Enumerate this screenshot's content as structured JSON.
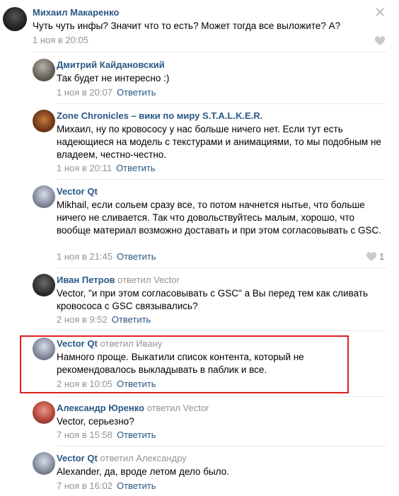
{
  "comments": [
    {
      "author": "Михаил Макаренко",
      "replied": "",
      "text": "Чуть чуть инфы? Значит что то есть? Может тогда все выложите? А?",
      "time": "1 ноя в 20:05",
      "reply": ""
    },
    {
      "author": "Дмитрий Кайдановский",
      "replied": "",
      "text": "Так будет не интересно :)",
      "time": "1 ноя в 20:07",
      "reply": "Ответить"
    },
    {
      "author": "Zone Chronicles – вики по миру S.T.A.L.K.E.R.",
      "replied": "",
      "text": "Михаил, ну по кровососу у нас больше ничего нет. Если тут есть надеющиеся на модель с текстурами и анимациями, то мы подобным не владеем, честно-честно.",
      "time": "1 ноя в 20:11",
      "reply": "Ответить"
    },
    {
      "author": "Vector Qt",
      "replied": "",
      "text": "Mikhail, если сольем сразу все, то потом начнется нытье, что больше ничего не сливается. Так что довольствуйтесь малым, хорошо, что вообще материал возможно доставать и при этом согласовывать с GSC.",
      "time": "1 ноя в 21:45",
      "reply": "Ответить",
      "likes": "1"
    },
    {
      "author": "Иван Петров",
      "replied": "ответил Vector",
      "text": "Vector, \"и при этом согласовывать с GSC\" а Вы перед тем как сливать кровососа с GSC связывались?",
      "time": "2 ноя в 9:52",
      "reply": "Ответить"
    },
    {
      "author": "Vector Qt",
      "replied": "ответил Ивану",
      "text": "Намного проще. Выкатили список контента, который не рекомендовалось выкладывать в паблик и все.",
      "time": "2 ноя в 10:05",
      "reply": "Ответить"
    },
    {
      "author": "Александр Юренко",
      "replied": "ответил Vector",
      "text": "Vector, серьезно?",
      "time": "7 ноя в 15:58",
      "reply": "Ответить"
    },
    {
      "author": "Vector Qt",
      "replied": "ответил Александру",
      "text": "Alexander, да, вроде летом дело было.",
      "time": "7 ноя в 16:02",
      "reply": "Ответить"
    }
  ],
  "colors": {
    "link": "#2a5885",
    "meta": "#939393",
    "highlight": "#e0201c"
  }
}
